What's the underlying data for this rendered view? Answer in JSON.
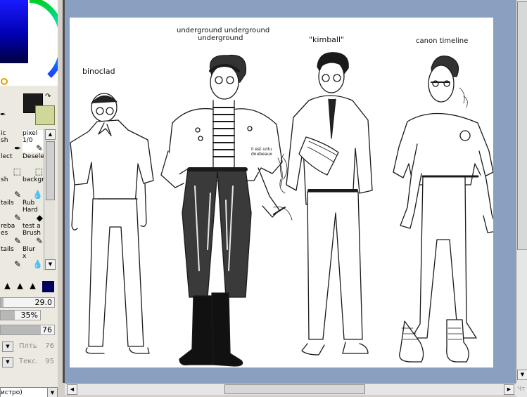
{
  "colors": {
    "foreground": "#1b1b1b",
    "background": "#cfd898",
    "workspace": "#8aa0c0"
  },
  "brushes": [
    {
      "line1": "ic",
      "line2": "sh",
      "icon": "pen-icon"
    },
    {
      "line1": "pixel",
      "line2": "1/0",
      "icon": "pencil-icon"
    },
    {
      "line1": "lect",
      "line2": "",
      "icon": "select-icon"
    },
    {
      "line1": "Deselect",
      "line2": "",
      "icon": "deselect-icon"
    },
    {
      "line1": "sh",
      "line2": "",
      "icon": "brush-icon"
    },
    {
      "line1": "backgrou",
      "line2": "",
      "icon": "dropper-icon"
    },
    {
      "line1": "tails",
      "line2": "",
      "icon": "brush-icon"
    },
    {
      "line1": "Rub",
      "line2": "Hard",
      "icon": "eraser-icon"
    },
    {
      "line1": "reba",
      "line2": "es",
      "icon": "brush-icon"
    },
    {
      "line1": "test a",
      "line2": "Brush",
      "icon": "brush-icon"
    },
    {
      "line1": "tails",
      "line2": "",
      "icon": "brush-icon"
    },
    {
      "line1": "Blur",
      "line2": "x",
      "icon": "dropper-icon"
    }
  ],
  "sliders": {
    "size": {
      "value": "29.0",
      "level": 0.05
    },
    "density": {
      "value": "35%",
      "level": 0.35
    },
    "min": {
      "value": "76",
      "level": 0.75
    }
  },
  "dropdowns": [
    {
      "label": "Плть",
      "value": "76"
    },
    {
      "label": "Текс.",
      "value": "95"
    }
  ],
  "mode_select": {
    "value": "истро)"
  },
  "canvas_labels": {
    "char1": "binoclad",
    "char2_line1": "underground underground",
    "char2_line2": "underground",
    "char3": "\"kimball\"",
    "char4": "canon timeline",
    "jacket_note": "il est unlu doubeaux"
  },
  "corner_text": "Чт"
}
